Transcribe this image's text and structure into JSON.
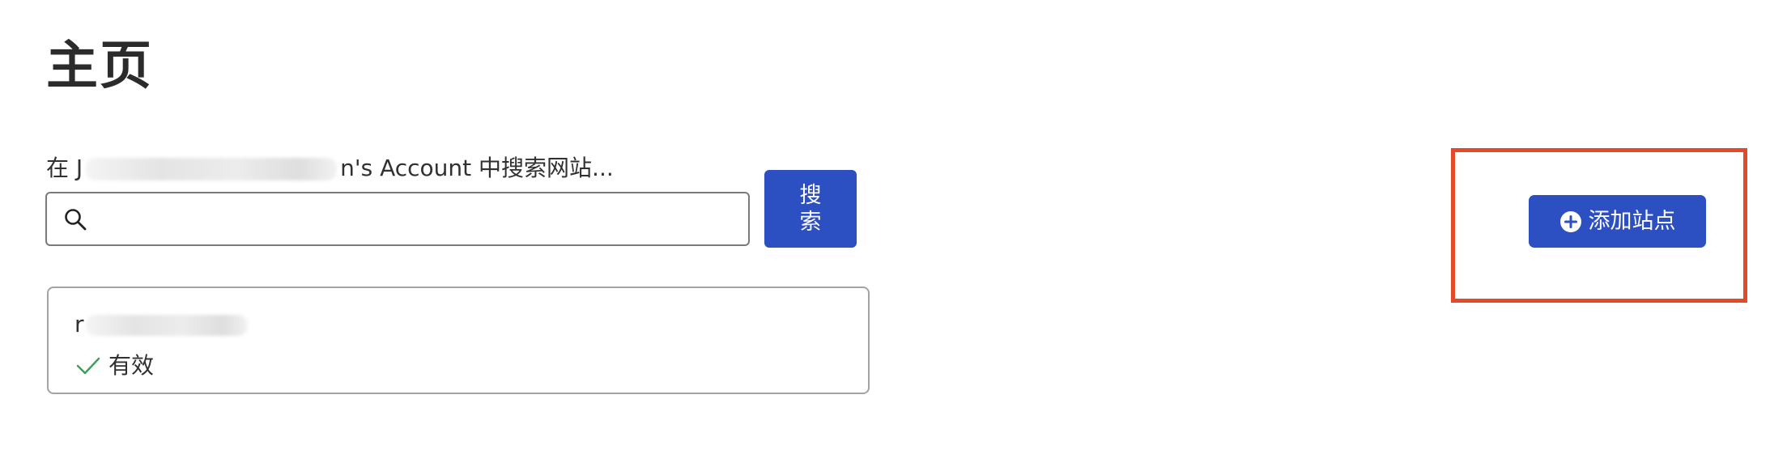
{
  "page": {
    "title": "主页"
  },
  "search": {
    "label_prefix": "在 J",
    "label_suffix": "n's Account 中搜索网站...",
    "placeholder": "",
    "value": "",
    "button_label": "搜索",
    "icon": "search-icon"
  },
  "sites": [
    {
      "name_prefix": "r",
      "status": "有效",
      "status_icon": "check-icon",
      "status_color": "#3aa05a"
    }
  ],
  "actions": {
    "add_site_label": "添加站点",
    "add_site_icon": "plus-circle-icon"
  },
  "colors": {
    "primary": "#2c4fc2",
    "highlight": "#e34a2a",
    "text": "#313131"
  }
}
